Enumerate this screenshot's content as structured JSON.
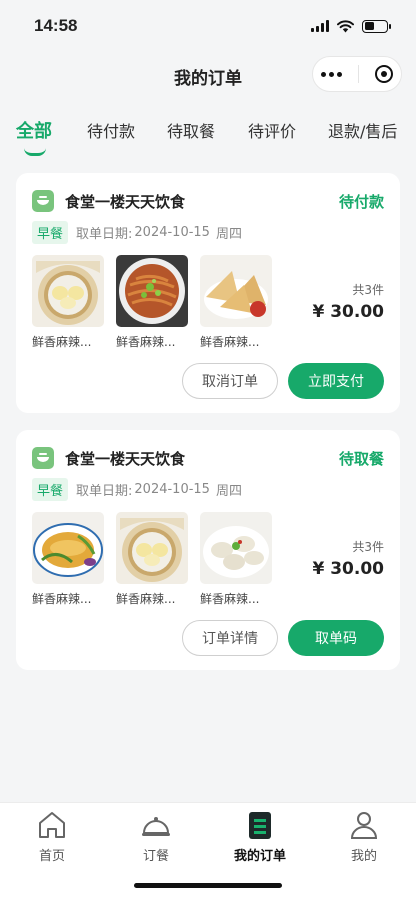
{
  "status_bar": {
    "time": "14:58"
  },
  "nav": {
    "title": "我的订单"
  },
  "tabs": [
    {
      "label": "全部",
      "active": true
    },
    {
      "label": "待付款"
    },
    {
      "label": "待取餐"
    },
    {
      "label": "待评价"
    },
    {
      "label": "退款/售后"
    }
  ],
  "orders": [
    {
      "store": "食堂一楼天天饮食",
      "status": "待付款",
      "meal_tag": "早餐",
      "pickup_label": "取单日期:",
      "pickup_date": "2024-10-15",
      "pickup_weekday": "周四",
      "items": [
        {
          "name": "鲜香麻辣...",
          "image": "steamed-rolls"
        },
        {
          "name": "鲜香麻辣...",
          "image": "spicy-noodles"
        },
        {
          "name": "鲜香麻辣...",
          "image": "samosa"
        }
      ],
      "count": "共3件",
      "price": "¥ 30.00",
      "secondary_button": "取消订单",
      "primary_button": "立即支付"
    },
    {
      "store": "食堂一楼天天饮食",
      "status": "待取餐",
      "meal_tag": "早餐",
      "pickup_label": "取单日期:",
      "pickup_date": "2024-10-15",
      "pickup_weekday": "周四",
      "items": [
        {
          "name": "鲜香麻辣...",
          "image": "braised-fish"
        },
        {
          "name": "鲜香麻辣...",
          "image": "steamed-rolls"
        },
        {
          "name": "鲜香麻辣...",
          "image": "dumplings"
        }
      ],
      "count": "共3件",
      "price": "¥ 30.00",
      "secondary_button": "订单详情",
      "primary_button": "取单码"
    }
  ],
  "tabbar": [
    {
      "label": "首页",
      "icon": "home-icon"
    },
    {
      "label": "订餐",
      "icon": "cloche-icon"
    },
    {
      "label": "我的订单",
      "icon": "order-list-icon",
      "active": true
    },
    {
      "label": "我的",
      "icon": "user-icon"
    }
  ],
  "colors": {
    "accent": "#17a96a",
    "tag_bg": "#e6f6ec",
    "store_icon": "#79c47d"
  }
}
